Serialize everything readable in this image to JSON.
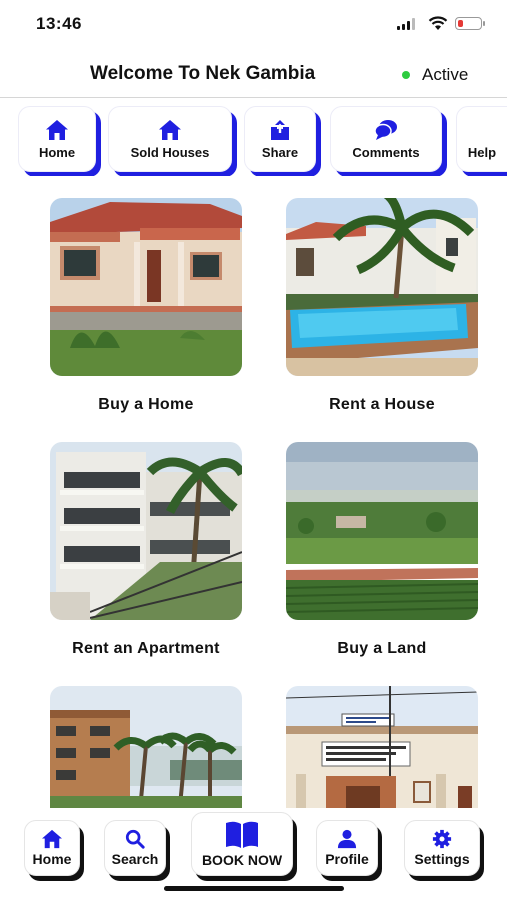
{
  "status_bar": {
    "time": "13:46",
    "battery_color": "#e53935",
    "battery_level": 0.25
  },
  "header": {
    "title": "Welcome To Nek Gambia",
    "status": "Active",
    "status_color": "#2ecc40"
  },
  "top_nav": {
    "accent": "#1f1fe0",
    "items": [
      {
        "label": "Home",
        "icon": "home-icon"
      },
      {
        "label": "Sold Houses",
        "icon": "home-icon"
      },
      {
        "label": "Share",
        "icon": "share-icon"
      },
      {
        "label": "Comments",
        "icon": "comments-icon"
      },
      {
        "label": "Help",
        "icon": "help-icon"
      }
    ]
  },
  "listings": [
    {
      "label": "Buy a Home",
      "image": "house-photo"
    },
    {
      "label": "Rent a House",
      "image": "pool-villa-photo"
    },
    {
      "label": "Rent an Apartment",
      "image": "apartment-block-photo"
    },
    {
      "label": "Buy a Land",
      "image": "farmland-photo"
    },
    {
      "label": "",
      "image": "resort-photo"
    },
    {
      "label": "",
      "image": "office-building-photo"
    }
  ],
  "bottom_nav": {
    "accent": "#1f1fe0",
    "items": [
      {
        "label": "Home",
        "icon": "home-icon"
      },
      {
        "label": "Search",
        "icon": "search-icon"
      },
      {
        "label": "BOOK NOW",
        "icon": "book-icon"
      },
      {
        "label": "Profile",
        "icon": "user-icon"
      },
      {
        "label": "Settings",
        "icon": "gear-icon"
      }
    ]
  }
}
